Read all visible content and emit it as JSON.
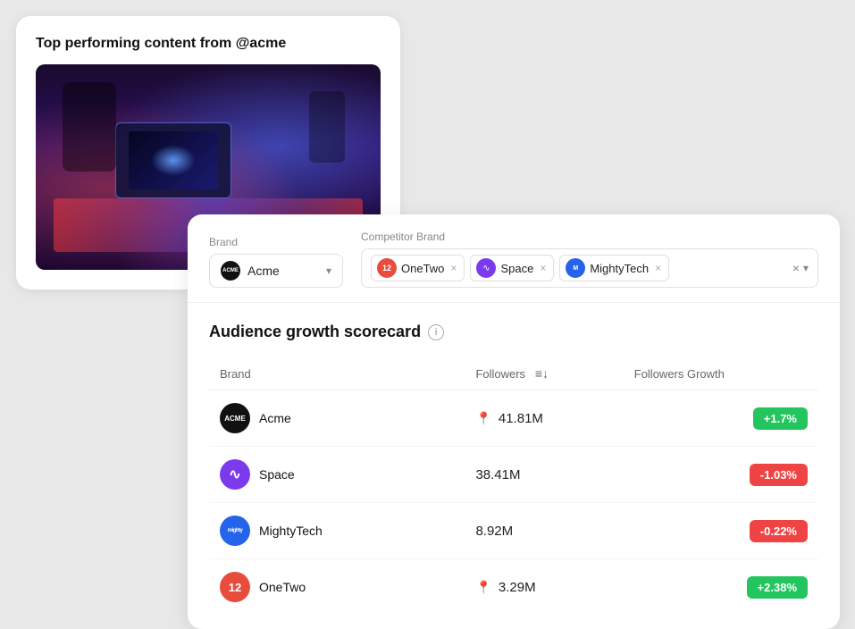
{
  "top_card": {
    "title": "Top performing content from @acme"
  },
  "brand_selector": {
    "brand_label": "Brand",
    "competitor_label": "Competitor Brand",
    "selected_brand": "Acme",
    "competitors": [
      {
        "id": "onetwo",
        "name": "OneTwo",
        "avatar_type": "onetwo",
        "avatar_text": "12"
      },
      {
        "id": "space",
        "name": "Space",
        "avatar_type": "space",
        "avatar_text": "∿"
      },
      {
        "id": "mightytech",
        "name": "MightyTech",
        "avatar_type": "mightytech",
        "avatar_text": "M"
      }
    ]
  },
  "scorecard": {
    "title": "Audience growth scorecard",
    "info_label": "i",
    "columns": {
      "brand": "Brand",
      "followers": "Followers",
      "growth": "Followers Growth"
    },
    "rows": [
      {
        "name": "Acme",
        "avatar_type": "acme",
        "avatar_text": "ACME",
        "followers": "41.81M",
        "growth": "+1.7%",
        "growth_type": "pos",
        "has_pin": true
      },
      {
        "name": "Space",
        "avatar_type": "space",
        "avatar_text": "∿",
        "followers": "38.41M",
        "growth": "-1.03%",
        "growth_type": "neg",
        "has_pin": false
      },
      {
        "name": "MightyTech",
        "avatar_type": "mighty",
        "avatar_text": "mighty",
        "followers": "8.92M",
        "growth": "-0.22%",
        "growth_type": "neg",
        "has_pin": false
      },
      {
        "name": "OneTwo",
        "avatar_type": "onetwo",
        "avatar_text": "12",
        "followers": "3.29M",
        "growth": "+2.38%",
        "growth_type": "pos",
        "has_pin": true
      }
    ]
  }
}
